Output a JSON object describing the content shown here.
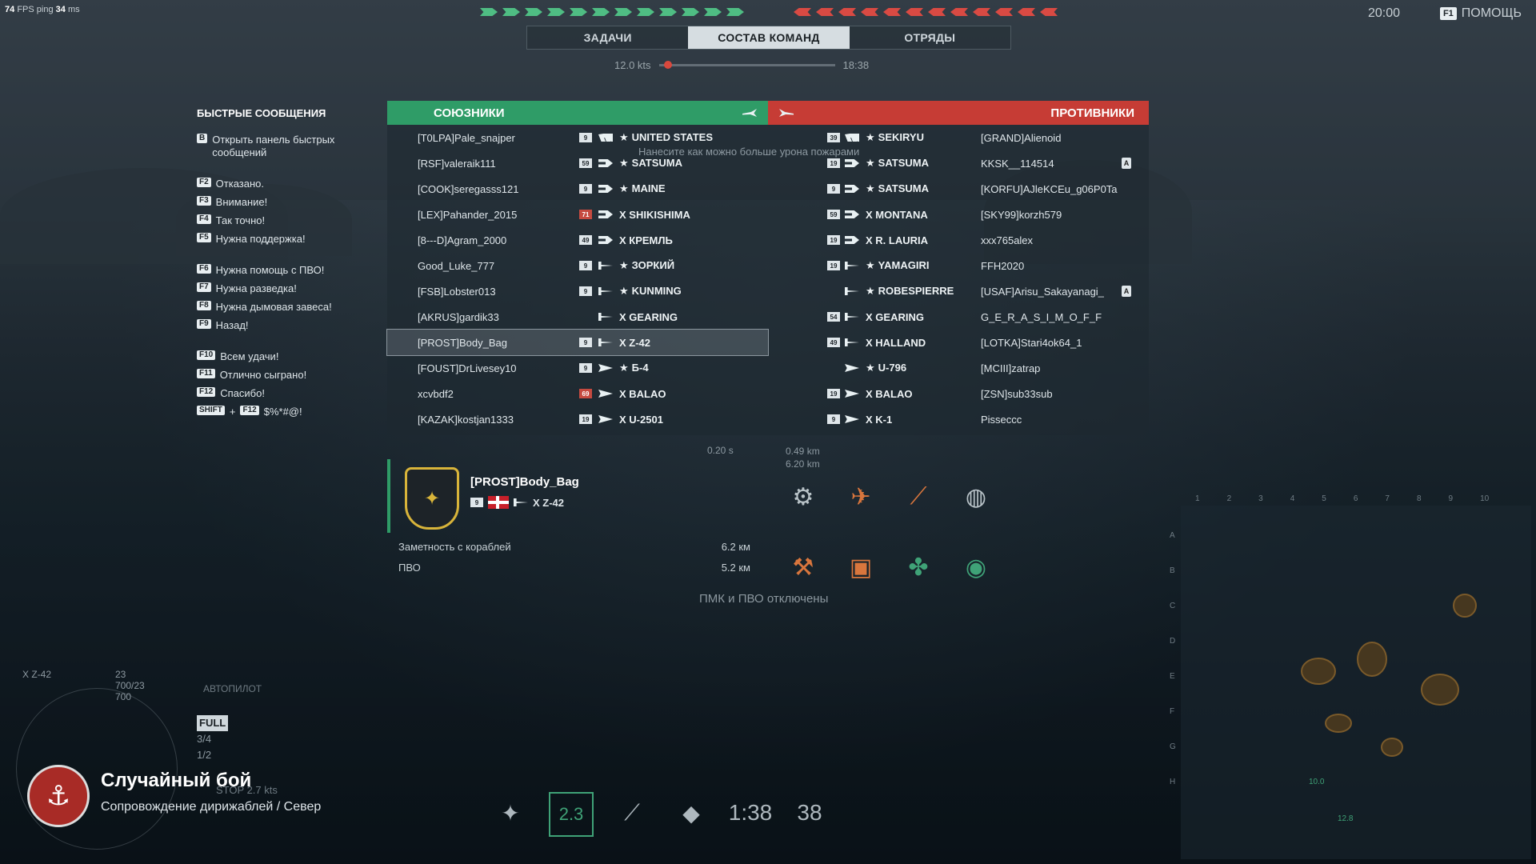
{
  "hud": {
    "fps_value": "74",
    "fps_label": "FPS",
    "ping_label": "ping",
    "ping_value": "34",
    "ping_unit": "ms",
    "clock": "20:00",
    "help_key": "F1",
    "help_label": "ПОМОЩЬ"
  },
  "tabs": [
    {
      "label": "ЗАДАЧИ"
    },
    {
      "label": "СОСТАВ КОМАНД"
    },
    {
      "label": "ОТРЯДЫ"
    }
  ],
  "timeline": {
    "speed": "12.0 kts",
    "time": "18:38"
  },
  "quick_messages": {
    "title": "БЫСТРЫЕ СООБЩЕНИЯ",
    "items": [
      {
        "key": "B",
        "label": "Открыть панель быстрых сообщений"
      },
      {
        "key": "F2",
        "label": "Отказано."
      },
      {
        "key": "F3",
        "label": "Внимание!"
      },
      {
        "key": "F4",
        "label": "Так точно!"
      },
      {
        "key": "F5",
        "label": "Нужна поддержка!"
      },
      {
        "key": "F6",
        "label": "Нужна помощь с ПВО!"
      },
      {
        "key": "F7",
        "label": "Нужна разведка!"
      },
      {
        "key": "F8",
        "label": "Нужна дымовая завеса!"
      },
      {
        "key": "F9",
        "label": "Назад!"
      },
      {
        "key": "F10",
        "label": "Всем удачи!"
      },
      {
        "key": "F11",
        "label": "Отлично сыграно!"
      },
      {
        "key": "F12",
        "label": "Спасибо!"
      },
      {
        "key": "SHIFT",
        "key2": "F12",
        "plus": "+",
        "label": "$%*#@!"
      }
    ]
  },
  "allies": {
    "title": "СОЮЗНИКИ",
    "players": [
      {
        "name": "[T0LPA]Pale_snajper",
        "level": "9",
        "ship": "UNITED STATES",
        "star": "★"
      },
      {
        "name": "[RSF]valeraik111",
        "level": "59",
        "ship": "SATSUMA",
        "star": "★"
      },
      {
        "name": "[COOK]seregasss121",
        "level": "9",
        "ship": "MAINE",
        "star": "★"
      },
      {
        "name": "[LEX]Pahander_2015",
        "level": "71",
        "ship": "X SHIKISHIMA"
      },
      {
        "name": "[8---D]Agram_2000",
        "level": "49",
        "ship": "X КРЕМЛЬ"
      },
      {
        "name": "Good_Luke_777",
        "level": "9",
        "ship": "ЗОРКИЙ",
        "star": "★"
      },
      {
        "name": "[FSB]Lobster013",
        "level": "9",
        "ship": "KUNMING",
        "star": "★"
      },
      {
        "name": "[AKRUS]gardik33",
        "level": "",
        "ship": "X GEARING"
      },
      {
        "name": "[PROST]Body_Bag",
        "level": "9",
        "ship": "X Z-42"
      },
      {
        "name": "[FOUST]DrLivesey10",
        "level": "9",
        "ship": "Б-4",
        "star": "★"
      },
      {
        "name": "xcvbdf2",
        "level": "69",
        "ship": "X BALAO"
      },
      {
        "name": "[KAZAK]kostjan1333",
        "level": "19",
        "ship": "X U-2501"
      }
    ]
  },
  "enemies": {
    "title": "ПРОТИВНИКИ",
    "players": [
      {
        "name": "[GRAND]Alienoid",
        "level": "39",
        "ship": "SEKIRYU",
        "star": "★"
      },
      {
        "name": "KKSK__114514",
        "level": "19",
        "ship": "SATSUMA",
        "star": "★",
        "badge": "A"
      },
      {
        "name": "[KORFU]AJleKCEu_g06P0Ta",
        "level": "9",
        "ship": "SATSUMA",
        "star": "★"
      },
      {
        "name": "[SKY99]korzh579",
        "level": "59",
        "ship": "X MONTANA"
      },
      {
        "name": "xxx765alex",
        "level": "19",
        "ship": "X R. LAURIA"
      },
      {
        "name": "FFH2020",
        "level": "19",
        "ship": "YAMAGIRI",
        "star": "★"
      },
      {
        "name": "[USAF]Arisu_Sakayanagi_",
        "level": "",
        "ship": "ROBESPIERRE",
        "star": "★",
        "badge": "A"
      },
      {
        "name": "G_E_R_A_S_I_M_O_F_F",
        "level": "54",
        "ship": "X GEARING"
      },
      {
        "name": "[LOTKA]Stari4ok64_1",
        "level": "49",
        "ship": "X HALLAND"
      },
      {
        "name": "[MCIII]zatrap",
        "level": "",
        "ship": "U-796",
        "star": "★"
      },
      {
        "name": "[ZSN]sub33sub",
        "level": "19",
        "ship": "X BALAO"
      },
      {
        "name": "Pisseccc",
        "level": "9",
        "ship": "X K-1"
      }
    ]
  },
  "mission_hint": "Нанесите как можно больше урона пожарами",
  "selected": {
    "name": "[PROST]Body_Bag",
    "level": "9",
    "ship": "X Z-42",
    "stats": [
      {
        "label": "Заметность с кораблей",
        "value": "6.2 км"
      },
      {
        "label": "ПВО",
        "value": "5.2 км"
      }
    ]
  },
  "aa_status": "ПМК и ПВО отключены",
  "reload": "0.20 s",
  "distances": [
    "0.49 km",
    "6.20 km"
  ],
  "battle": {
    "title": "Случайный бой",
    "subtitle": "Сопровождение дирижаблей / Север"
  },
  "own_ship": {
    "name": "X Z-42",
    "hp": "23 700/23 700"
  },
  "engine": {
    "full": "FULL",
    "three_quarter": "3/4",
    "half": "1/2",
    "stop": "STOP",
    "speed": "2.7 kts",
    "autopilot": "АВТОПИЛОТ"
  },
  "bottom_bar": {
    "ammo": "2.3",
    "timer": "1:38",
    "count": "38"
  },
  "minimap": {
    "letters": [
      "A",
      "B",
      "C",
      "D",
      "E",
      "F",
      "G",
      "H"
    ],
    "numbers": [
      "1",
      "2",
      "3",
      "4",
      "5",
      "6",
      "7",
      "8",
      "9",
      "10"
    ],
    "range": "10.0",
    "range2": "12.8"
  },
  "colors": {
    "ally": "#2f9c67",
    "enemy": "#c63c35"
  }
}
